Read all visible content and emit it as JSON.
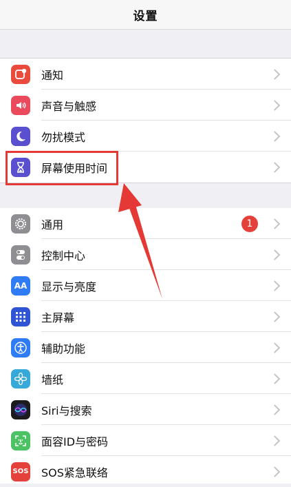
{
  "navbar": {
    "title": "设置"
  },
  "group1": [
    {
      "label": "通知",
      "icon": "notification-icon",
      "color": "#e94c3c"
    },
    {
      "label": "声音与触感",
      "icon": "sound-icon",
      "color": "#ea4a5b"
    },
    {
      "label": "勿扰模式",
      "icon": "moon-icon",
      "color": "#5a4fcf"
    },
    {
      "label": "屏幕使用时间",
      "icon": "hourglass-icon",
      "color": "#5a4fcf"
    }
  ],
  "group2": [
    {
      "label": "通用",
      "icon": "gear-icon",
      "color": "#8e8e93",
      "badge": "1"
    },
    {
      "label": "控制中心",
      "icon": "toggles-icon",
      "color": "#8e8e93"
    },
    {
      "label": "显示与亮度",
      "icon": "text-size-icon",
      "color": "#2f7cf6",
      "glyph": "AA"
    },
    {
      "label": "主屏幕",
      "icon": "home-grid-icon",
      "color": "#2f55d4"
    },
    {
      "label": "辅助功能",
      "icon": "accessibility-icon",
      "color": "#2f7cf6"
    },
    {
      "label": "墙纸",
      "icon": "flower-icon",
      "color": "#36a9d8"
    },
    {
      "label": "Siri与搜索",
      "icon": "siri-icon",
      "color": "#1c1c1e"
    },
    {
      "label": "面容ID与密码",
      "icon": "face-id-icon",
      "color": "#4cc264"
    },
    {
      "label": "SOS紧急联络",
      "icon": "sos-icon",
      "color": "#e5413b",
      "glyph": "SOS"
    }
  ],
  "annotation": {
    "highlight_color": "#e53935"
  }
}
